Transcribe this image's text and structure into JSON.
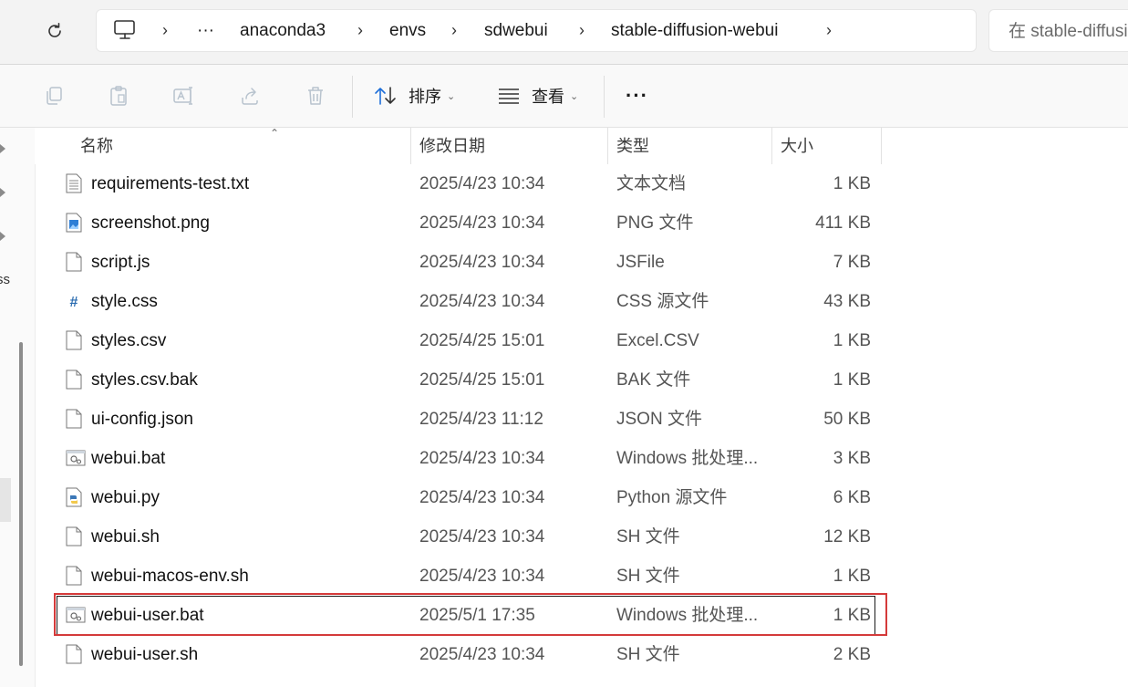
{
  "address_bar": {
    "breadcrumbs": [
      "anaconda3",
      "envs",
      "sdwebui",
      "stable-diffusion-webui"
    ],
    "overflow": "···",
    "search_placeholder": "在 stable-diffusion-webui 中搜索"
  },
  "toolbar": {
    "sort_label": "排序",
    "view_label": "查看",
    "more_label": "···"
  },
  "nav": {
    "truncated_label": "ss"
  },
  "columns": {
    "name": "名称",
    "date": "修改日期",
    "type": "类型",
    "size": "大小"
  },
  "files": [
    {
      "name": "requirements-test.txt",
      "date": "2025/4/23 10:34",
      "type": "文本文档",
      "size": "1 KB",
      "icon": "text-file-icon"
    },
    {
      "name": "screenshot.png",
      "date": "2025/4/23 10:34",
      "type": "PNG 文件",
      "size": "411 KB",
      "icon": "image-file-icon"
    },
    {
      "name": "script.js",
      "date": "2025/4/23 10:34",
      "type": "JSFile",
      "size": "7 KB",
      "icon": "file-icon"
    },
    {
      "name": "style.css",
      "date": "2025/4/23 10:34",
      "type": "CSS 源文件",
      "size": "43 KB",
      "icon": "css-file-icon"
    },
    {
      "name": "styles.csv",
      "date": "2025/4/25 15:01",
      "type": "Excel.CSV",
      "size": "1 KB",
      "icon": "file-icon"
    },
    {
      "name": "styles.csv.bak",
      "date": "2025/4/25 15:01",
      "type": "BAK 文件",
      "size": "1 KB",
      "icon": "file-icon"
    },
    {
      "name": "ui-config.json",
      "date": "2025/4/23 11:12",
      "type": "JSON 文件",
      "size": "50 KB",
      "icon": "file-icon"
    },
    {
      "name": "webui.bat",
      "date": "2025/4/23 10:34",
      "type": "Windows 批处理...",
      "size": "3 KB",
      "icon": "batch-file-icon"
    },
    {
      "name": "webui.py",
      "date": "2025/4/23 10:34",
      "type": "Python 源文件",
      "size": "6 KB",
      "icon": "python-file-icon"
    },
    {
      "name": "webui.sh",
      "date": "2025/4/23 10:34",
      "type": "SH 文件",
      "size": "12 KB",
      "icon": "file-icon"
    },
    {
      "name": "webui-macos-env.sh",
      "date": "2025/4/23 10:34",
      "type": "SH 文件",
      "size": "1 KB",
      "icon": "file-icon"
    },
    {
      "name": "webui-user.bat",
      "date": "2025/5/1 17:35",
      "type": "Windows 批处理...",
      "size": "1 KB",
      "icon": "batch-file-icon",
      "focused": true
    },
    {
      "name": "webui-user.sh",
      "date": "2025/4/23 10:34",
      "type": "SH 文件",
      "size": "2 KB",
      "icon": "file-icon"
    }
  ],
  "colors": {
    "highlight_box": "#d43a3a",
    "accent_blue": "#1e6fd9"
  }
}
